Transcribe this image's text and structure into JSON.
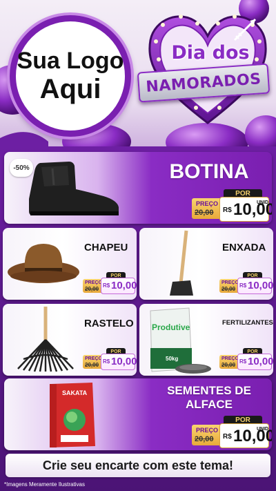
{
  "header": {
    "logo_line1": "Sua Logo",
    "logo_line2": "Aqui",
    "event_line1": "Dia dos",
    "event_line2": "NAMORADOS"
  },
  "colors": {
    "accent": "#7a1fb0",
    "background": "#5a1a86",
    "price_gold": "#e8a93a",
    "badge_black": "#1a1a1a"
  },
  "price_labels": {
    "por": "POR",
    "preco": "PREÇO",
    "old": "20,00",
    "currency": "R$",
    "new": "10,00",
    "unit": "UNID"
  },
  "products": [
    {
      "name": "BOTINA",
      "discount": "-50%",
      "icon": "boot-image"
    },
    {
      "name": "CHAPEU",
      "icon": "hat-image"
    },
    {
      "name": "ENXADA",
      "icon": "hoe-image"
    },
    {
      "name": "RASTELO",
      "icon": "rake-image"
    },
    {
      "name": "FERTILIZANTES",
      "icon": "fertilizer-bag-image",
      "bag_brand": "Produtive",
      "bag_weight": "50kg"
    },
    {
      "name": "SEMENTES DE ALFACE",
      "name_line1": "SEMENTES DE",
      "name_line2": "ALFACE",
      "icon": "seed-packet-image",
      "packet_brand": "SAKATA"
    }
  ],
  "footer": {
    "cta": "Crie seu encarte com este tema!",
    "note": "*Imagens Meramente Ilustrativas"
  }
}
